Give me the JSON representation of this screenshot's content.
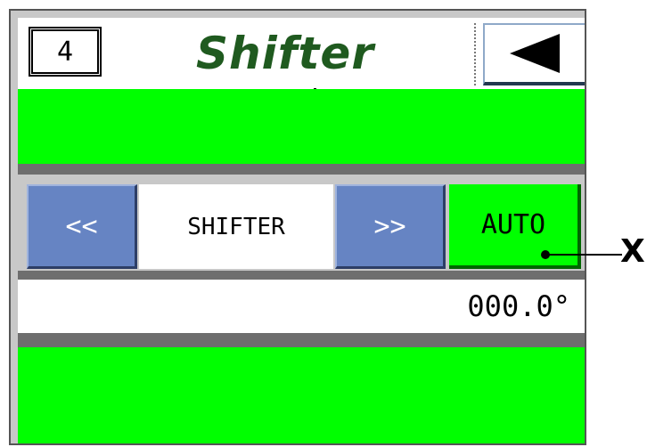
{
  "header": {
    "page_number": "4",
    "title": "Shifter",
    "back_icon": "left-triangle-icon"
  },
  "controls": {
    "prev_label": "<<",
    "mode_label": "SHIFTER",
    "next_label": ">>",
    "auto_label": "AUTO"
  },
  "readout": {
    "value": "000.0°"
  },
  "callout": {
    "label": "X"
  },
  "colors": {
    "status_green": "#00ff00",
    "title_green": "#1f5a1f",
    "button_blue": "#6684c3",
    "strip_gray": "#6e6e6e"
  }
}
